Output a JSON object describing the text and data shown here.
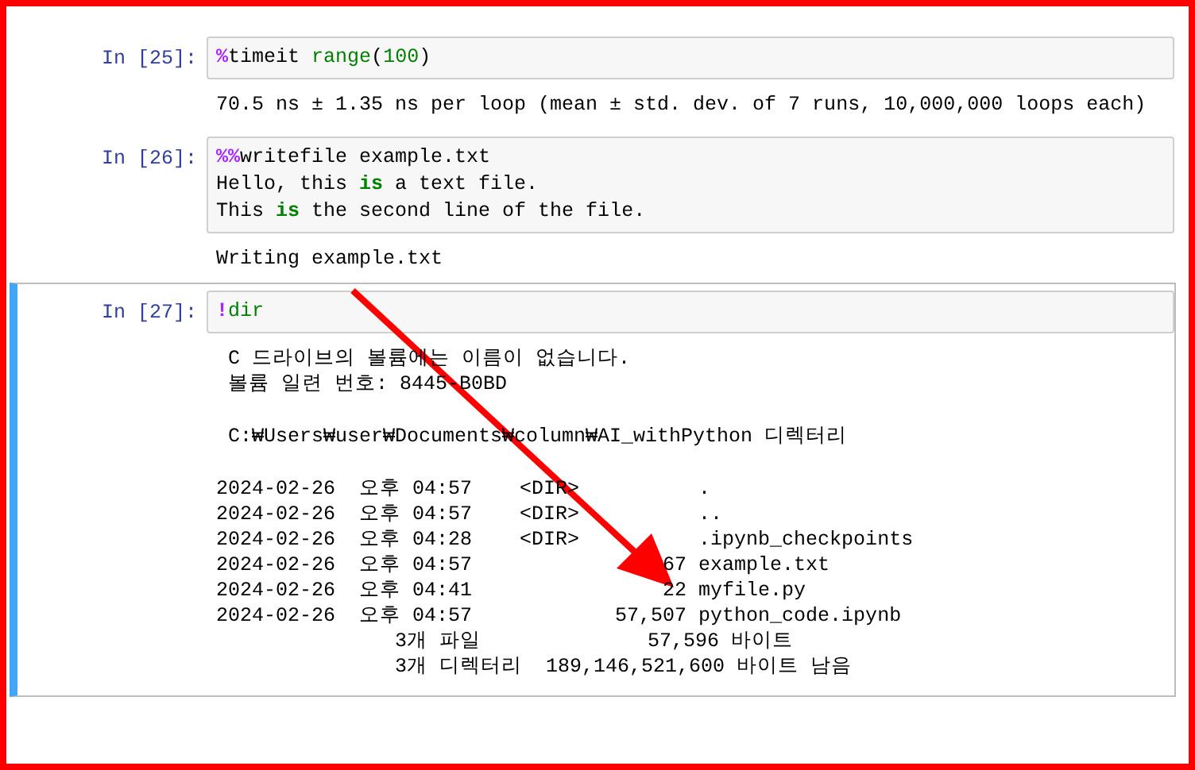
{
  "cells": [
    {
      "prompt": "In [25]:",
      "selected": false,
      "input": [
        [
          {
            "kind": "magic",
            "text": "%"
          },
          {
            "kind": "plain",
            "text": "timeit "
          },
          {
            "kind": "builtin",
            "text": "range"
          },
          {
            "kind": "plain",
            "text": "("
          },
          {
            "kind": "number",
            "text": "100"
          },
          {
            "kind": "plain",
            "text": ")"
          }
        ]
      ],
      "output": [
        [
          "70.5 ns ± 1.35 ns per loop (mean ± std. dev. of 7 runs, 10,000,000 loops each)"
        ]
      ]
    },
    {
      "prompt": "In [26]:",
      "selected": false,
      "input": [
        [
          {
            "kind": "magic",
            "text": "%%"
          },
          {
            "kind": "plain",
            "text": "writefile example.txt"
          }
        ],
        [
          {
            "kind": "plain",
            "text": "Hello, this "
          },
          {
            "kind": "keyword",
            "text": "is"
          },
          {
            "kind": "plain",
            "text": " a text file."
          }
        ],
        [
          {
            "kind": "plain",
            "text": "This "
          },
          {
            "kind": "keyword",
            "text": "is"
          },
          {
            "kind": "plain",
            "text": " the second line of the file."
          }
        ]
      ],
      "output": [
        [
          "Writing example.txt"
        ]
      ]
    },
    {
      "prompt": "In [27]:",
      "selected": true,
      "input": [
        [
          {
            "kind": "magic",
            "text": "!"
          },
          {
            "kind": "builtin",
            "text": "dir"
          }
        ]
      ],
      "output": [
        [
          " C 드라이브의 볼륨에는 이름이 없습니다.",
          " 볼륨 일련 번호: 8445-B0BD"
        ],
        [
          " C:₩Users₩user₩Documents₩column₩AI_withPython 디렉터리"
        ],
        [
          "2024-02-26  오후 04:57    <DIR>          .",
          "2024-02-26  오후 04:57    <DIR>          ..",
          "2024-02-26  오후 04:28    <DIR>          .ipynb_checkpoints",
          "2024-02-26  오후 04:57                67 example.txt",
          "2024-02-26  오후 04:41                22 myfile.py",
          "2024-02-26  오후 04:57            57,507 python_code.ipynb",
          "               3개 파일              57,596 바이트",
          "               3개 디렉터리  189,146,521,600 바이트 남음"
        ]
      ]
    }
  ]
}
